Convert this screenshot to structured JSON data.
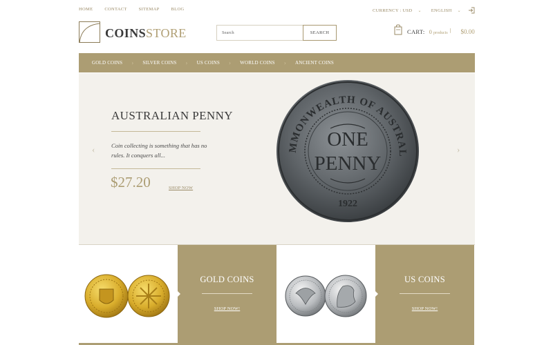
{
  "topbar": {
    "links": [
      "HOME",
      "CONTACT",
      "SITEMAP",
      "BLOG"
    ],
    "currency": "CURRENCY : USD",
    "language": "ENGLISH"
  },
  "logo": {
    "bold": "COINS",
    "light": "STORE"
  },
  "search": {
    "placeholder": "Search",
    "button": "SEARCH"
  },
  "cart": {
    "label": "CART:",
    "count": "0",
    "count_unit": "products",
    "separator": "⦚",
    "total": "$0.00"
  },
  "nav": {
    "items": [
      "GOLD COINS",
      "SILVER COINS",
      "US COINS",
      "WORLD COINS",
      "ANCIENT COINS"
    ]
  },
  "hero": {
    "title": "AUSTRALIAN PENNY",
    "description": "Coin collecting is something that has no rules. It conquers all...",
    "price": "$27.20",
    "shop": "SHOP NOW",
    "coin": {
      "top_text": "COMMONWEALTH OF AUSTRALIA",
      "line1": "ONE",
      "line2": "PENNY",
      "year": "1922"
    }
  },
  "tiles": [
    {
      "title": "GOLD COINS",
      "shop": "SHOP NOW!"
    },
    {
      "title": "US COINS",
      "shop": "SHOP NOW!"
    }
  ],
  "colors": {
    "accent": "#ac9d73",
    "hero_bg": "#f3f1ec",
    "text": "#3a3a3a"
  },
  "icons": [
    "logo-mark-icon",
    "exit-icon",
    "bag-icon",
    "chevron-left-icon",
    "chevron-right-icon",
    "chevron-down-icon"
  ]
}
